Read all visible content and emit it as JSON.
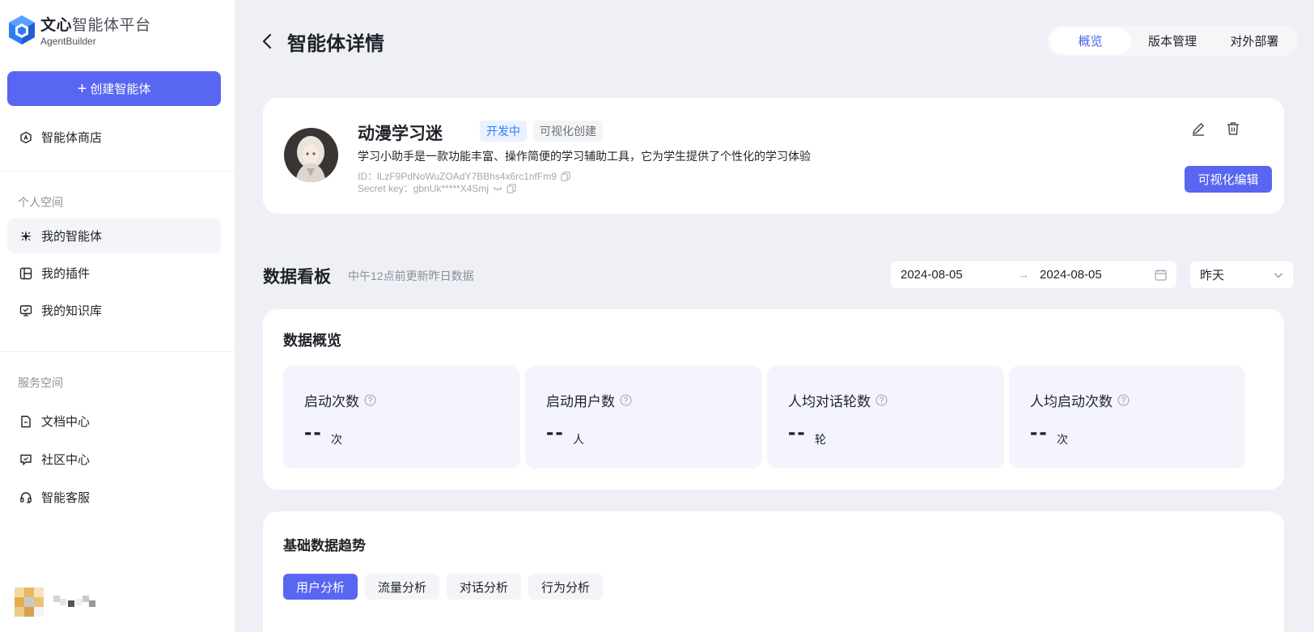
{
  "brand": {
    "title_bold": "文心",
    "title_rest": "智能体平台",
    "subtitle": "AgentBuilder"
  },
  "sidebar": {
    "create_label": "创建智能体",
    "store_label": "智能体商店",
    "personal_section": "个人空间",
    "personal_items": [
      {
        "label": "我的智能体",
        "icon": "sparkle-icon"
      },
      {
        "label": "我的插件",
        "icon": "plugin-icon"
      },
      {
        "label": "我的知识库",
        "icon": "knowledge-icon"
      }
    ],
    "service_section": "服务空间",
    "service_items": [
      {
        "label": "文档中心",
        "icon": "document-icon"
      },
      {
        "label": "社区中心",
        "icon": "chat-bubble-icon"
      },
      {
        "label": "智能客服",
        "icon": "headset-icon"
      }
    ]
  },
  "header": {
    "title": "智能体详情",
    "tabs": [
      "概览",
      "版本管理",
      "对外部署"
    ],
    "active_tab": "概览"
  },
  "agent": {
    "name": "动漫学习迷",
    "status_badge": "开发中",
    "type_badge": "可视化创建",
    "description": "学习小助手是一款功能丰富、操作简便的学习辅助工具，它为学生提供了个性化的学习体验",
    "id_text": "ID：lLzF9PdNoWuZOAdY7BBhs4x6rc1nfFm9",
    "secret_text": "Secret key：gbnUk*****X4Smj",
    "edit_button": "可视化编辑"
  },
  "dashboard": {
    "title": "数据看板",
    "hint": "中午12点前更新昨日数据",
    "date_start": "2024-08-05",
    "date_arrow": "→",
    "date_end": "2024-08-05",
    "period": "昨天"
  },
  "overview": {
    "title": "数据概览",
    "metrics": [
      {
        "label": "启动次数",
        "value": "--",
        "unit": "次"
      },
      {
        "label": "启动用户数",
        "value": "--",
        "unit": "人"
      },
      {
        "label": "人均对话轮数",
        "value": "--",
        "unit": "轮"
      },
      {
        "label": "人均启动次数",
        "value": "--",
        "unit": "次"
      }
    ]
  },
  "trend": {
    "title": "基础数据趋势",
    "tabs": [
      "用户分析",
      "流量分析",
      "对话分析",
      "行为分析"
    ],
    "active_tab": "用户分析"
  },
  "colors": {
    "accent": "#5866f1",
    "active_tab_text": "#4a63e8",
    "dev_badge": "#2e7cf6",
    "metric_bg": "#f4f5fc"
  }
}
